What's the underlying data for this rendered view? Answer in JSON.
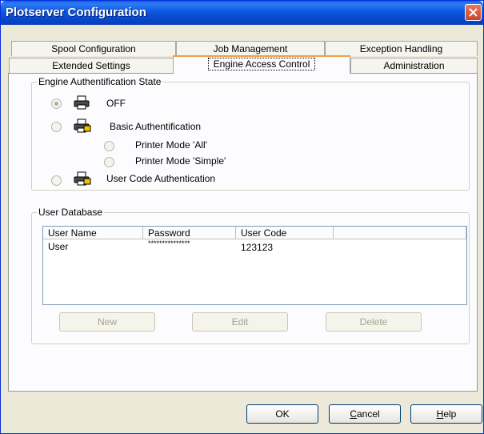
{
  "window": {
    "title": "Plotserver Configuration"
  },
  "tabs": {
    "row1": [
      "Spool Configuration",
      "Job Management",
      "Exception Handling"
    ],
    "row2": [
      "Extended Settings",
      "Engine Access Control",
      "Administration"
    ]
  },
  "auth": {
    "group_label": "Engine Authentification State",
    "off": "OFF",
    "basic": "Basic Authentification",
    "mode_all": "Printer Mode 'All'",
    "mode_simple": "Printer Mode 'Simple'",
    "usercode": "User Code Authentication",
    "selected": "off"
  },
  "userdb": {
    "group_label": "User Database",
    "columns": [
      "User Name",
      "Password",
      "User Code"
    ],
    "rows": [
      {
        "name": "User",
        "password": "***************",
        "code": "123123"
      }
    ],
    "buttons": {
      "new": "New",
      "edit": "Edit",
      "delete": "Delete"
    }
  },
  "footer": {
    "ok": "OK",
    "cancel_first": "C",
    "cancel_rest": "ancel",
    "help_first": "H",
    "help_rest": "elp"
  }
}
